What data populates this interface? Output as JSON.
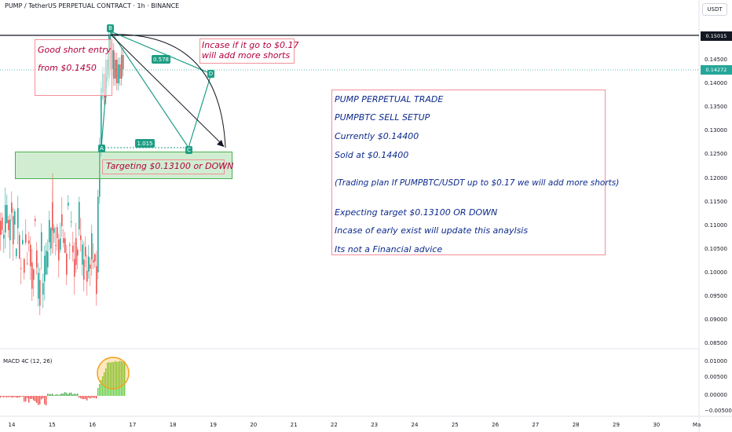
{
  "header": {
    "title": "PUMP / TetherUS PERPETUAL CONTRACT · 1h · BINANCE",
    "currency": "USDT"
  },
  "price_axis": {
    "labels": [
      "0.14500",
      "0.14000",
      "0.13500",
      "0.13000",
      "0.12500",
      "0.12000",
      "0.11500",
      "0.11000",
      "0.10500",
      "0.10000",
      "0.09500",
      "0.09000",
      "0.08500"
    ],
    "high_tag": "0.15015",
    "current_tag": "0.14272"
  },
  "macd": {
    "title": "MACD 4C (12, 26)",
    "labels": [
      "0.01000",
      "0.00500",
      "0.00000",
      "−0.00500"
    ]
  },
  "time_axis": [
    "14",
    "15",
    "16",
    "17",
    "18",
    "19",
    "20",
    "21",
    "22",
    "23",
    "24",
    "25",
    "26",
    "27",
    "28",
    "29",
    "30",
    "Ma"
  ],
  "annotations": {
    "entry_line1": "Good short entry",
    "entry_line2": "from $0.1450",
    "add_line1": "Incase if it go to $0.17",
    "add_line2": "will add more shorts",
    "target": "Targeting $0.13100 or DOWN"
  },
  "pattern": {
    "point_b": "B",
    "point_a": "A",
    "point_c": "C",
    "point_d": "D",
    "ratio_bd": "0.578",
    "ratio_ac": "1.015"
  },
  "trade_box": {
    "lines": [
      "PUMP PERPETUAL TRADE",
      "PUMPBTC SELL SETUP",
      "Currently $0.14400",
      "Sold at $0.14400",
      "(Trading plan If PUMPBTC/USDT up to $0.17 we will add more shorts)",
      "Expecting target $0.13100 OR DOWN",
      "Incase of early exist will update this anaylsis",
      "Its not a Financial advice"
    ]
  },
  "colors": {
    "up": "#26a69a",
    "down": "#ef5350",
    "pattern": "#1e9e84",
    "box_border": "#f2909a",
    "target_fill": "#d8f0d8"
  }
}
